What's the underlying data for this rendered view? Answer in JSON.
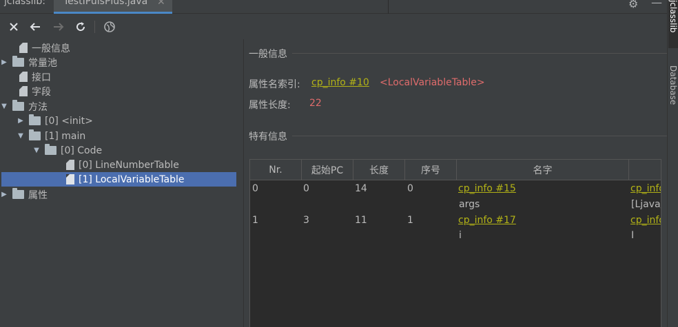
{
  "tabbar": {
    "tool_title": "jclasslib:",
    "file_tab": "TestIPulsPlus.java",
    "close_glyph": "✕"
  },
  "toolbar": {
    "icons": [
      "close-icon",
      "back-icon",
      "forward-icon",
      "refresh-icon",
      "web-icon"
    ]
  },
  "tree": {
    "items": [
      {
        "label": "一般信息",
        "type": "file"
      },
      {
        "label": "常量池",
        "type": "folder",
        "expanded": false
      },
      {
        "label": "接口",
        "type": "file"
      },
      {
        "label": "字段",
        "type": "file"
      },
      {
        "label": "方法",
        "type": "folder",
        "expanded": true
      },
      {
        "label": "[0] <init>",
        "type": "folder",
        "expanded": false
      },
      {
        "label": "[1] main",
        "type": "folder",
        "expanded": true
      },
      {
        "label": "[0] Code",
        "type": "folder",
        "expanded": true
      },
      {
        "label": "[0] LineNumberTable",
        "type": "file"
      },
      {
        "label": "[1] LocalVariableTable",
        "type": "file",
        "selected": true
      },
      {
        "label": "属性",
        "type": "folder",
        "expanded": false
      }
    ]
  },
  "detail": {
    "general_title": "一般信息",
    "name_index_label": "属性名索引:",
    "name_index_link": "cp_info #10",
    "name_index_value": "<LocalVariableTable>",
    "length_label": "属性长度:",
    "length_value": "22",
    "specific_title": "特有信息"
  },
  "table": {
    "headers": [
      "Nr.",
      "起始PC",
      "长度",
      "序号",
      "名字",
      ""
    ],
    "rows": [
      {
        "nr": "0",
        "start_pc": "0",
        "length": "14",
        "index": "0",
        "name_link": "cp_info #15",
        "name_value": "args",
        "desc_link": "cp_info",
        "desc_value": "[Ljava/"
      },
      {
        "nr": "1",
        "start_pc": "3",
        "length": "11",
        "index": "1",
        "name_link": "cp_info #17",
        "name_value": "i",
        "desc_link": "cp_info",
        "desc_value": "I"
      }
    ]
  },
  "sidestrip": {
    "jclasslib": "jclasslib",
    "database": "Database"
  },
  "colors": {
    "background": "#3c3f41",
    "selection": "#4b6eaf",
    "link": "#b3b316",
    "red_value": "#e06c6c",
    "table_bg": "#2b2b2b"
  }
}
